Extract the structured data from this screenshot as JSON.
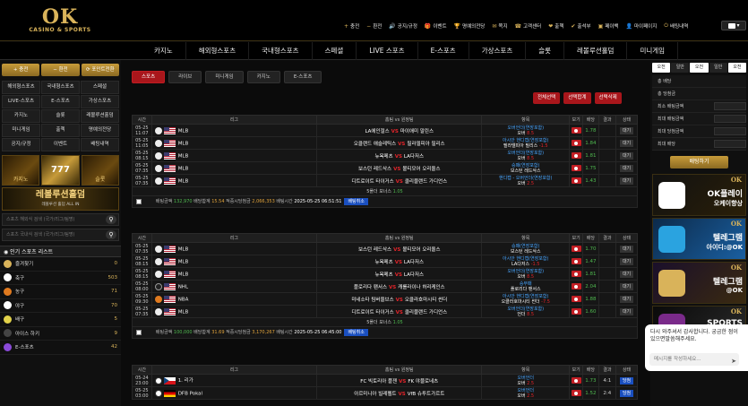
{
  "header": {
    "logo_big": "OK",
    "logo_small": "CASINO & SPORTS",
    "links": [
      {
        "icon": "+",
        "label": "충전"
      },
      {
        "icon": "−",
        "label": "환전"
      },
      {
        "icon": "🔊",
        "label": "공지/규정"
      },
      {
        "icon": "🎁",
        "label": "이벤트"
      },
      {
        "icon": "🏆",
        "label": "명예의전당"
      },
      {
        "icon": "✉",
        "label": "쪽지"
      },
      {
        "icon": "☎",
        "label": "고객센터"
      },
      {
        "icon": "❤",
        "label": "출첵"
      },
      {
        "icon": "✔",
        "label": "출석부"
      },
      {
        "icon": "▣",
        "label": "페이백"
      },
      {
        "icon": "👤",
        "label": "마이페이지"
      },
      {
        "icon": "⏻",
        "label": "배팅내역"
      }
    ],
    "flag_label": "▾"
  },
  "mainnav": [
    "카지노",
    "해외형스포츠",
    "국내형스포츠",
    "스페셜",
    "LIVE 스포츠",
    "E-스포츠",
    "가상스포츠",
    "슬롯",
    "레볼루션홀덤",
    "미니게임"
  ],
  "left": {
    "buttons": [
      "충전",
      "환전",
      "포인트전환"
    ],
    "grid": [
      "해외형스포츠",
      "국내형스포츠",
      "스페셜",
      "LIVE-스포츠",
      "E-스포츠",
      "가상스포츠",
      "카지노",
      "슬롯",
      "레볼루션홀덤",
      "미니게임",
      "출첵",
      "명예의전당",
      "공지/규정",
      "이벤트",
      "배팅내역"
    ],
    "promo_left": "카지노",
    "promo_mid": "777",
    "promo_right": "슬롯",
    "promo_holdem": "레볼루션홀덤",
    "promo_holdem_sub": "레볼루션 홀덤 ALL IN",
    "search1": "스포츠 해외식 검색 (국가/리그/팀명)",
    "search2": "스포츠 국내식 검색 (국가/리그/팀명)",
    "sports_head": "인기 스포츠 리스트",
    "sports": [
      {
        "name": "즐겨찾기",
        "count": "0",
        "color": "#d9b35a"
      },
      {
        "name": "축구",
        "count": "503",
        "color": "#ffffff"
      },
      {
        "name": "농구",
        "count": "71",
        "color": "#e07a1f"
      },
      {
        "name": "야구",
        "count": "70",
        "color": "#ffffff"
      },
      {
        "name": "배구",
        "count": "5",
        "color": "#e2d24a"
      },
      {
        "name": "아이스 하키",
        "count": "9",
        "color": "#444444"
      },
      {
        "name": "E-스포츠",
        "count": "42",
        "color": "#8a4ad9"
      }
    ]
  },
  "center": {
    "tabs": [
      "스포츠",
      "라이브",
      "미니게임",
      "카지노",
      "E-스포츠"
    ],
    "actions": [
      "전체선택",
      "선택합계",
      "선택삭제"
    ],
    "headers": [
      "시간",
      "리그",
      "홈팀 vs 원정팀",
      "항목",
      "보기",
      "배당",
      "결과",
      "상태"
    ],
    "tables": [
      {
        "rows": [
          {
            "date": "05-25",
            "time": "11:07",
            "league": "MLB",
            "flag": "us",
            "ball": "",
            "home": "LA에인절스",
            "away": "마이애미 말린스",
            "p1": "오버언더(연장포함)",
            "p2": "오버",
            "od": "8.5",
            "odds": "1.78",
            "result": "",
            "status": "대기"
          },
          {
            "date": "05-25",
            "time": "11:05",
            "league": "MLB",
            "flag": "us",
            "ball": "",
            "home": "오클랜드 애슬레틱스",
            "away": "필라델피아 필리스",
            "p1": "아시안 핸디캡(연장포함)",
            "p2": "필라델피아 필리스",
            "od": "-1.5",
            "odds": "1.84",
            "result": "",
            "status": "대기"
          },
          {
            "date": "05-25",
            "time": "08:15",
            "league": "MLB",
            "flag": "us",
            "ball": "",
            "home": "뉴욕메츠",
            "away": "LA다저스",
            "p1": "오버언더(연장포함)",
            "p2": "오버",
            "od": "8.5",
            "odds": "1.81",
            "result": "",
            "status": "대기"
          },
          {
            "date": "05-25",
            "time": "07:35",
            "league": "MLB",
            "flag": "us",
            "ball": "",
            "home": "보스턴 레드삭스",
            "away": "볼티모어 오리올스",
            "p1": "승패(연장포함)",
            "p2": "보스턴 레드삭스",
            "od": "",
            "odds": "1.75",
            "result": "",
            "status": "대기"
          },
          {
            "date": "05-25",
            "time": "07:35",
            "league": "MLB",
            "flag": "us",
            "ball": "",
            "home": "디트로이트 타이거스",
            "away": "클리블랜드 가디언스",
            "p1": "핸디캡 - 오버언더(연장포함)",
            "p2": "오버",
            "od": "2.5",
            "odds": "1.43",
            "result": "",
            "status": "대기"
          }
        ],
        "summary_label": "5폴더 보너스",
        "summary_value": "1.05",
        "bet_amount": "132,970",
        "odds_total": "15.54",
        "expected": "2,066,353",
        "bet_time": "2025-05-25 06:51:51",
        "cancel": "배팅취소"
      },
      {
        "rows": [
          {
            "date": "05-25",
            "time": "07:35",
            "league": "MLB",
            "flag": "us",
            "ball": "",
            "home": "보스턴 레드삭스",
            "away": "볼티모어 오리올스",
            "p1": "승패(연장포함)",
            "p2": "보스턴 레드삭스",
            "od": "",
            "odds": "1.70",
            "result": "",
            "status": "대기"
          },
          {
            "date": "05-25",
            "time": "08:15",
            "league": "MLB",
            "flag": "us",
            "ball": "",
            "home": "뉴욕메츠",
            "away": "LA다저스",
            "p1": "아시안 핸디캡(연장포함)",
            "p2": "LA다저스",
            "od": "-1.5",
            "odds": "1.47",
            "result": "",
            "status": "대기"
          },
          {
            "date": "05-25",
            "time": "08:15",
            "league": "MLB",
            "flag": "us",
            "ball": "",
            "home": "뉴욕메츠",
            "away": "LA다저스",
            "p1": "오버언더(연장포함)",
            "p2": "오버",
            "od": "8.5",
            "odds": "1.81",
            "result": "",
            "status": "대기"
          },
          {
            "date": "05-25",
            "time": "08:00",
            "league": "NHL",
            "flag": "us",
            "ball": "hockey",
            "home": "플로리다 팬서스",
            "away": "캐롤라이나 허리케인스",
            "p1": "승무패",
            "p2": "플로리다 팬서스",
            "od": "",
            "odds": "2.04",
            "result": "",
            "status": "대기"
          },
          {
            "date": "05-25",
            "time": "09:30",
            "league": "NBA",
            "flag": "us",
            "ball": "basket",
            "home": "미네소타 팀버울브스",
            "away": "오클라호마시티 썬더",
            "p1": "아시안 핸디캡(연장포함)",
            "p2": "오클라호마시티 썬더",
            "od": "-7.5",
            "odds": "1.88",
            "result": "",
            "status": "대기"
          },
          {
            "date": "05-25",
            "time": "07:35",
            "league": "MLB",
            "flag": "us",
            "ball": "",
            "home": "디트로이트 타이거스",
            "away": "클리블랜드 가디언스",
            "p1": "오버언더(연장포함)",
            "p2": "언더",
            "od": "8.5",
            "odds": "1.60",
            "result": "",
            "status": "대기"
          }
        ],
        "summary_label": "5폴더 보너스",
        "summary_value": "1.05",
        "bet_amount": "100,000",
        "odds_total": "31.69",
        "expected": "3,170,267",
        "bet_time": "2025-05-25 06:45:00",
        "cancel": "배팅취소"
      },
      {
        "rows": [
          {
            "date": "05-24",
            "time": "23:00",
            "league": "1. 리가",
            "flag": "cz",
            "ball": "soccer",
            "home": "FC 빅토리아 플젠",
            "away": "FK 야블로네츠",
            "p1": "오버언더",
            "p2": "오버",
            "od": "2.5",
            "odds": "1.73",
            "result": "4:1",
            "status": "당첨"
          },
          {
            "date": "05-25",
            "time": "03:00",
            "league": "DFB Pokal",
            "flag": "de",
            "ball": "soccer",
            "home": "아르미니아 빌레펠트",
            "away": "VfB 슈투트가르트",
            "p1": "오버언더",
            "p2": "오버",
            "od": "2.5",
            "odds": "1.52",
            "result": "2:4",
            "status": "당첨"
          }
        ]
      }
    ],
    "betinfo_labels": {
      "amount": "배팅금액",
      "odds": "배당합계",
      "expected": "적중시당첨금",
      "time": "배팅시간"
    }
  },
  "right": {
    "tabs": [
      "오전",
      "일반",
      "오전",
      "일반",
      "오전"
    ],
    "rows": [
      "총 배당",
      "총 당첨금",
      "최소 배팅금액",
      "최대 배팅금액",
      "최대 당첨금액",
      "최대 배당"
    ],
    "bet_button": "배팅하기",
    "banners": [
      {
        "title": "OK플레이",
        "sub": "오케이향상",
        "ok": "OK"
      },
      {
        "title": "텔레그램",
        "sub": "아이디:@OK",
        "ok": "OK"
      },
      {
        "title": "텔레그램",
        "sub": "@OK",
        "ok": "OK"
      },
      {
        "title": "SPORTS",
        "sub": "",
        "ok": "OK"
      }
    ]
  },
  "chat": {
    "message": "다시 와주셔서 감사합니다. 궁금한 점이 있으면말씀해주세요.",
    "placeholder": "메시지를 작성하세요...",
    "send_icon": "➤"
  }
}
